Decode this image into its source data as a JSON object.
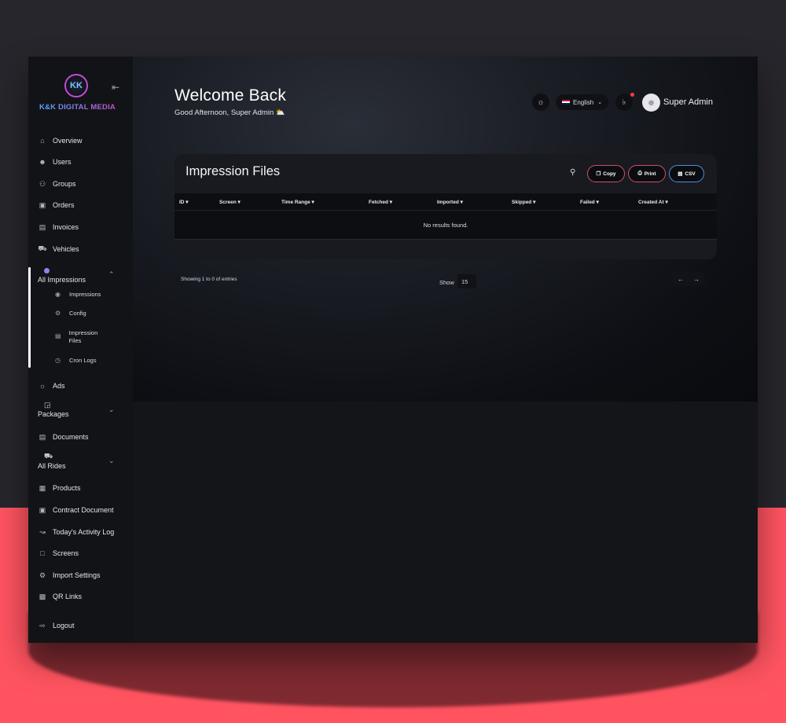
{
  "brand": {
    "logo_initials": "KK",
    "name": "K&K DIGITAL MEDIA"
  },
  "sidebar": {
    "items": [
      {
        "label": "Overview",
        "icon": "home-icon"
      },
      {
        "label": "Users",
        "icon": "user-icon"
      },
      {
        "label": "Groups",
        "icon": "group-icon"
      },
      {
        "label": "Orders",
        "icon": "orders-icon"
      },
      {
        "label": "Invoices",
        "icon": "invoice-icon"
      },
      {
        "label": "Vehicles",
        "icon": "vehicle-icon"
      }
    ],
    "impressions_group": {
      "label": "All Impressions",
      "expanded": true,
      "sub_items": [
        {
          "label": "Impressions",
          "icon": "eye-icon"
        },
        {
          "label": "Config",
          "icon": "gear-icon"
        },
        {
          "label": "Impression Files",
          "icon": "file-icon",
          "active": true
        },
        {
          "label": "Cron Logs",
          "icon": "clock-icon"
        }
      ]
    },
    "ads": {
      "label": "Ads",
      "icon": "ads-icon"
    },
    "packages": {
      "label": "Packages",
      "icon": "box-icon"
    },
    "documents": {
      "label": "Documents",
      "icon": "document-icon"
    },
    "all_rides": {
      "label": "All Rides",
      "icon": "car-icon"
    },
    "lower_items": [
      {
        "label": "Products",
        "icon": "grid-icon"
      },
      {
        "label": "Contract Document",
        "icon": "contract-icon"
      },
      {
        "label": "Today's Activity Log",
        "icon": "chart-icon"
      },
      {
        "label": "Screens",
        "icon": "screen-icon"
      },
      {
        "label": "Import Settings",
        "icon": "settings-icon"
      },
      {
        "label": "QR Links",
        "icon": "qr-icon"
      }
    ],
    "logout": {
      "label": "Logout",
      "icon": "logout-icon"
    }
  },
  "header": {
    "title": "Welcome Back",
    "greeting": "Good Afternoon, Super Admin ⛅",
    "language": "English",
    "user_name": "Super Admin"
  },
  "card": {
    "title": "Impression Files",
    "buttons": {
      "copy": "Copy",
      "print": "Print",
      "csv": "CSV"
    },
    "columns": [
      "ID",
      "Screen",
      "Time Range",
      "Fetched",
      "Imported",
      "Skipped",
      "Failed",
      "Created At"
    ],
    "empty_message": "No results found."
  },
  "footer": {
    "showing": "Showing 1 to 0 of entries",
    "show_label": "Show",
    "page_size": "15",
    "prev": "←",
    "next": "→"
  },
  "colors": {
    "accent_pink": "#d0506a",
    "accent_blue": "#4f8ee8",
    "background_red": "#ff5460"
  }
}
